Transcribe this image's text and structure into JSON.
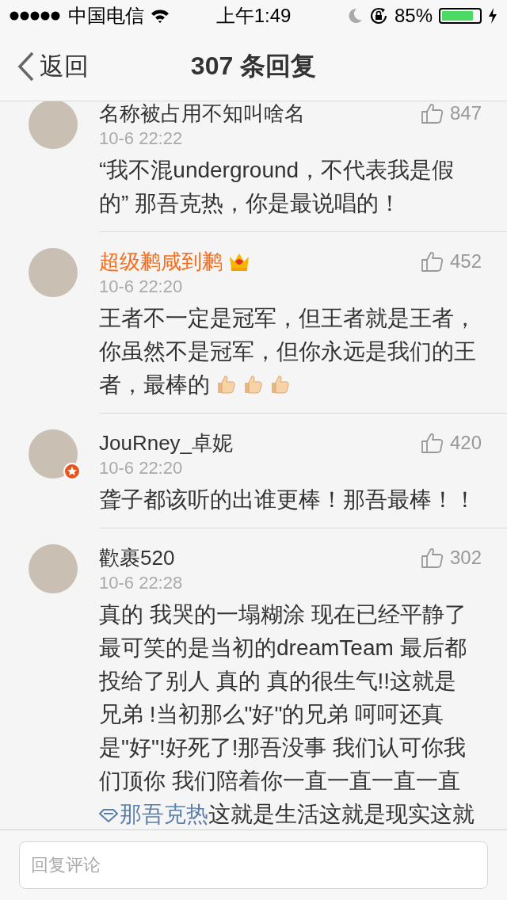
{
  "status_bar": {
    "carrier": "中国电信",
    "time": "上午1:49",
    "battery_text": "85%",
    "battery": {
      "level": 0.85
    }
  },
  "nav": {
    "back": "返回",
    "title": "307 条回复"
  },
  "comments": [
    {
      "name": "名称被占用不知叫啥名",
      "member": false,
      "verified": false,
      "time": "10-6 22:22",
      "likes": "847",
      "body": [
        {
          "kind": "text",
          "text": "“我不混underground，不代表我是假的” 那吾克热，你是最说唱的！"
        }
      ]
    },
    {
      "name": "超级鹣咸到鹣",
      "member": true,
      "verified": false,
      "time": "10-6 22:20",
      "likes": "452",
      "body": [
        {
          "kind": "text",
          "text": "王者不一定是冠军，但王者就是王者，你虽然不是冠军，但你永远是我们的王者，最棒的"
        }
      ],
      "emojis": [
        {
          "kind": "thumbs-up"
        },
        {
          "kind": "thumbs-up"
        },
        {
          "kind": "thumbs-up"
        }
      ]
    },
    {
      "name": "JouRney_卓妮",
      "member": false,
      "verified": true,
      "time": "10-6 22:20",
      "likes": "420",
      "body": [
        {
          "kind": "text",
          "text": "聋子都该听的出谁更棒！那吾最棒！！"
        }
      ]
    },
    {
      "name": "歡裹520",
      "member": false,
      "verified": false,
      "time": "10-6 22:28",
      "likes": "302",
      "body": [
        {
          "kind": "text",
          "text": "真的 我哭的一塌糊涂 现在已经平静了最可笑的是当初的dreamTeam 最后都投给了别人 真的 真的很生气!!这就是兄弟 !当初那么\"好\"的兄弟 呵呵还真是\"好\"!好死了!那吾没事 我们认可你我们顶你 我们陪着你一直一直一直一直"
        },
        {
          "kind": "link",
          "text": "那吾克热"
        },
        {
          "kind": "text",
          "text": "这就是生活这就是现实这就"
        }
      ]
    }
  ],
  "reply_field": {
    "placeholder": "回复评论"
  }
}
